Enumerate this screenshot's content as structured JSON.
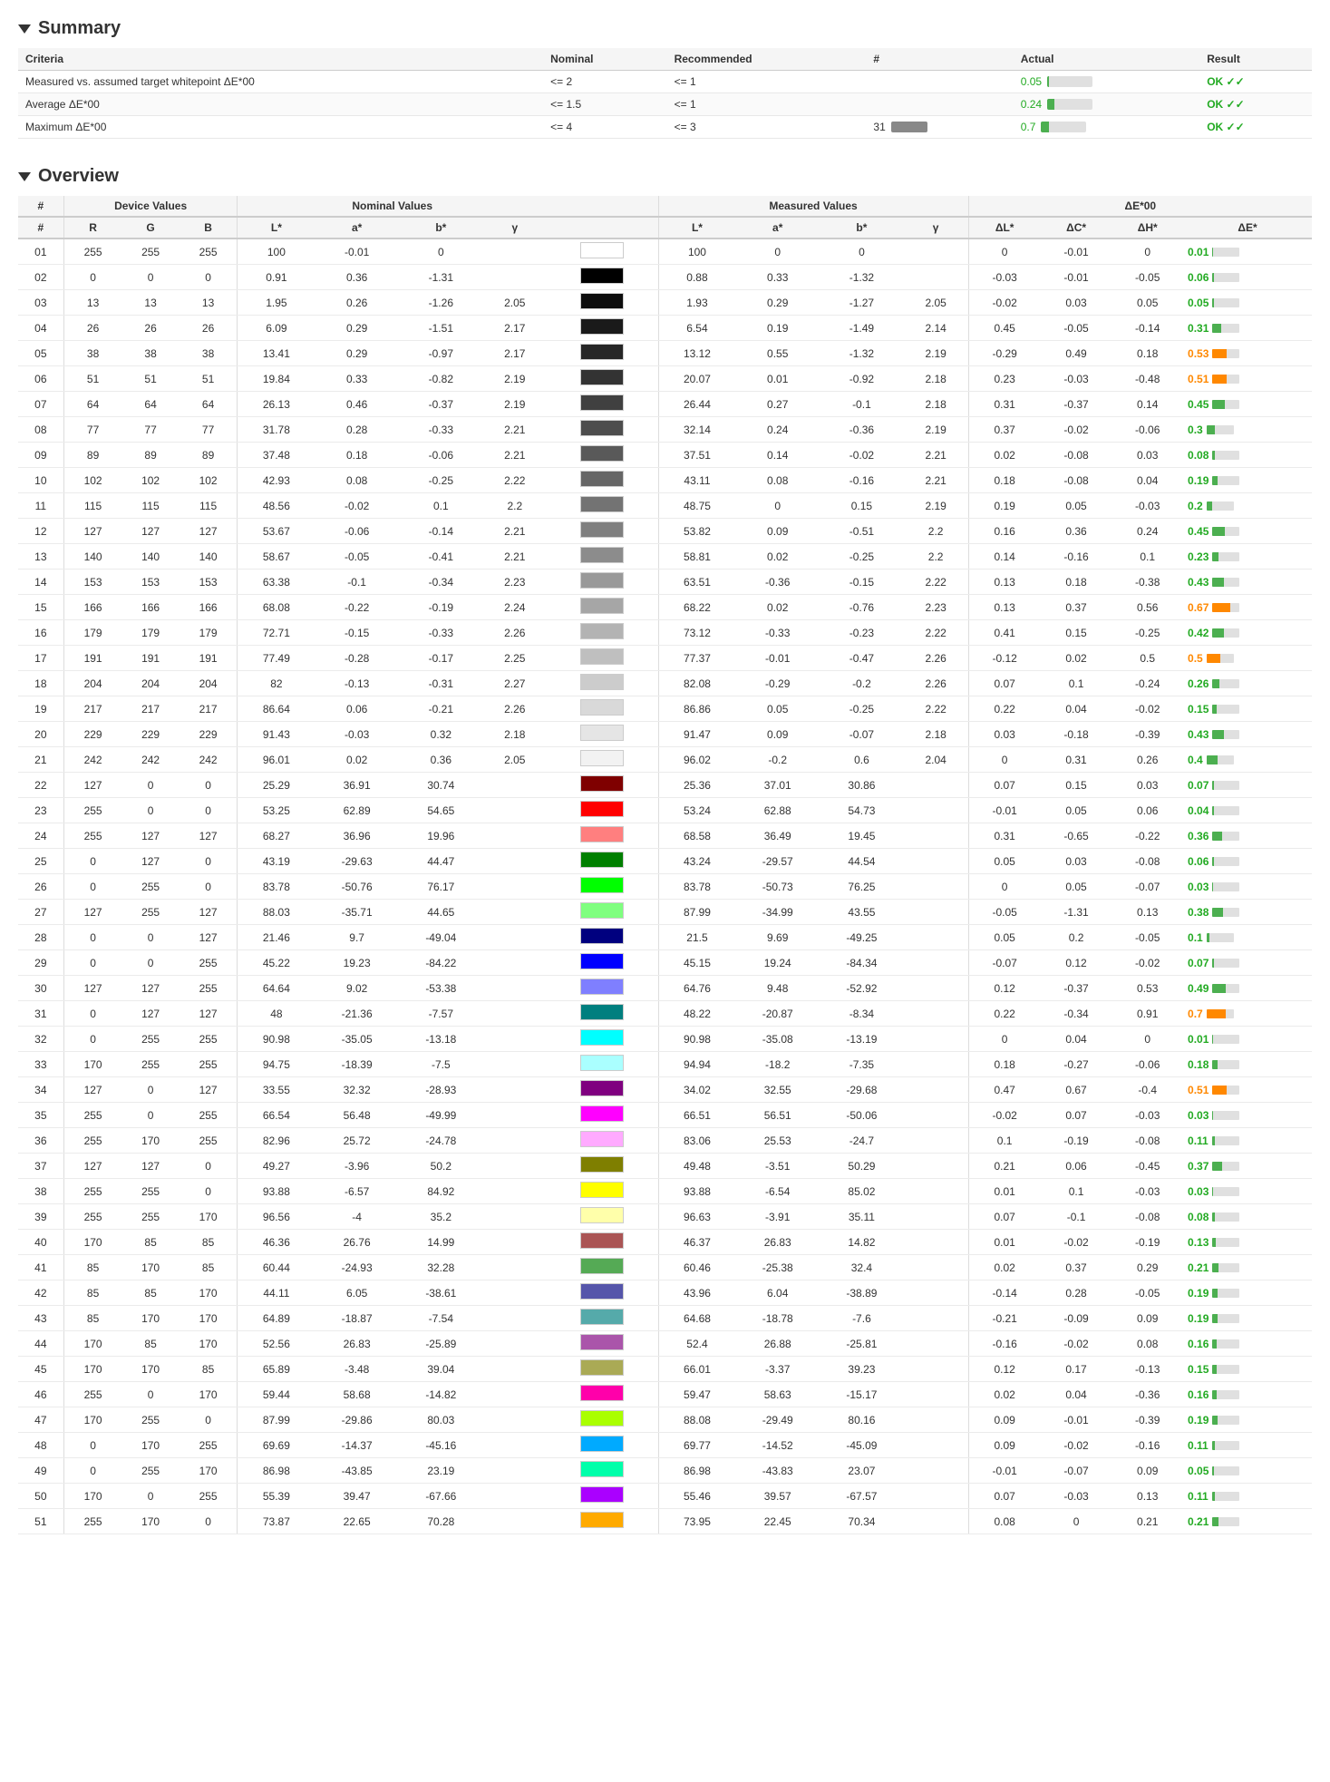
{
  "summary": {
    "title": "Summary",
    "headers": [
      "Criteria",
      "Nominal",
      "Recommended",
      "#",
      "Actual",
      "Result"
    ],
    "rows": [
      {
        "criteria": "Measured vs. assumed target whitepoint ΔE*00",
        "nominal": "<= 2",
        "recommended": "<= 1",
        "count": "",
        "actual": "0.05",
        "actualBarPct": 3,
        "result": "OK ✓✓"
      },
      {
        "criteria": "Average ΔE*00",
        "nominal": "<= 1.5",
        "recommended": "<= 1",
        "count": "",
        "actual": "0.24",
        "actualBarPct": 16,
        "result": "OK ✓✓"
      },
      {
        "criteria": "Maximum ΔE*00",
        "nominal": "<= 4",
        "recommended": "<= 3",
        "count": "31",
        "actual": "0.7",
        "actualBarPct": 18,
        "result": "OK ✓✓"
      }
    ]
  },
  "overview": {
    "title": "Overview",
    "groupHeaders": [
      "#",
      "Device Values",
      "",
      "",
      "Nominal Values",
      "",
      "",
      "",
      "Measured Values",
      "",
      "",
      "",
      "ΔE*00",
      "",
      "",
      ""
    ],
    "subHeaders": [
      "#",
      "R",
      "G",
      "B",
      "L*",
      "a*",
      "b*",
      "γ",
      "swatch",
      "L*",
      "a*",
      "b*",
      "γ",
      "ΔL*",
      "ΔC*",
      "ΔH*",
      "ΔE*"
    ],
    "rows": [
      {
        "num": "01",
        "R": 255,
        "G": 255,
        "B": 255,
        "Ln": 100,
        "an": -0.01,
        "bn": 0,
        "gn": "",
        "swatch": "#ffffff",
        "Lm": 100,
        "am": 0,
        "bm": 0,
        "gm": "",
        "dL": 0,
        "dC": -0.01,
        "dH": 0,
        "dE": 0.01
      },
      {
        "num": "02",
        "R": 0,
        "G": 0,
        "B": 0,
        "Ln": 0.91,
        "an": 0.36,
        "bn": -1.31,
        "gn": "",
        "swatch": "#000000",
        "Lm": 0.88,
        "am": 0.33,
        "bm": -1.32,
        "gm": "",
        "dL": -0.03,
        "dC": -0.01,
        "dH": -0.05,
        "dE": 0.06
      },
      {
        "num": "03",
        "R": 13,
        "G": 13,
        "B": 13,
        "Ln": 1.95,
        "an": 0.26,
        "bn": -1.26,
        "gn": 2.05,
        "swatch": "#0d0d0d",
        "Lm": 1.93,
        "am": 0.29,
        "bm": -1.27,
        "gm": 2.05,
        "dL": -0.02,
        "dC": 0.03,
        "dH": 0.05,
        "dE": 0.05
      },
      {
        "num": "04",
        "R": 26,
        "G": 26,
        "B": 26,
        "Ln": 6.09,
        "an": 0.29,
        "bn": -1.51,
        "gn": 2.17,
        "swatch": "#1a1a1a",
        "Lm": 6.54,
        "am": 0.19,
        "bm": -1.49,
        "gm": 2.14,
        "dL": 0.45,
        "dC": -0.05,
        "dH": -0.14,
        "dE": 0.31
      },
      {
        "num": "05",
        "R": 38,
        "G": 38,
        "B": 38,
        "Ln": 13.41,
        "an": 0.29,
        "bn": -0.97,
        "gn": 2.17,
        "swatch": "#262626",
        "Lm": 13.12,
        "am": 0.55,
        "bm": -1.32,
        "gm": 2.19,
        "dL": -0.29,
        "dC": 0.49,
        "dH": 0.18,
        "dE": 0.53
      },
      {
        "num": "06",
        "R": 51,
        "G": 51,
        "B": 51,
        "Ln": 19.84,
        "an": 0.33,
        "bn": -0.82,
        "gn": 2.19,
        "swatch": "#333333",
        "Lm": 20.07,
        "am": 0.01,
        "bm": -0.92,
        "gm": 2.18,
        "dL": 0.23,
        "dC": -0.03,
        "dH": -0.48,
        "dE": 0.51
      },
      {
        "num": "07",
        "R": 64,
        "G": 64,
        "B": 64,
        "Ln": 26.13,
        "an": 0.46,
        "bn": -0.37,
        "gn": 2.19,
        "swatch": "#404040",
        "Lm": 26.44,
        "am": 0.27,
        "bm": -0.1,
        "gm": 2.18,
        "dL": 0.31,
        "dC": -0.37,
        "dH": 0.14,
        "dE": 0.45
      },
      {
        "num": "08",
        "R": 77,
        "G": 77,
        "B": 77,
        "Ln": 31.78,
        "an": 0.28,
        "bn": -0.33,
        "gn": 2.21,
        "swatch": "#4d4d4d",
        "Lm": 32.14,
        "am": 0.24,
        "bm": -0.36,
        "gm": 2.19,
        "dL": 0.37,
        "dC": -0.02,
        "dH": -0.06,
        "dE": 0.3
      },
      {
        "num": "09",
        "R": 89,
        "G": 89,
        "B": 89,
        "Ln": 37.48,
        "an": 0.18,
        "bn": -0.06,
        "gn": 2.21,
        "swatch": "#595959",
        "Lm": 37.51,
        "am": 0.14,
        "bm": -0.02,
        "gm": 2.21,
        "dL": 0.02,
        "dC": -0.08,
        "dH": 0.03,
        "dE": 0.08
      },
      {
        "num": "10",
        "R": 102,
        "G": 102,
        "B": 102,
        "Ln": 42.93,
        "an": 0.08,
        "bn": -0.25,
        "gn": 2.22,
        "swatch": "#666666",
        "Lm": 43.11,
        "am": 0.08,
        "bm": -0.16,
        "gm": 2.21,
        "dL": 0.18,
        "dC": -0.08,
        "dH": 0.04,
        "dE": 0.19
      },
      {
        "num": "11",
        "R": 115,
        "G": 115,
        "B": 115,
        "Ln": 48.56,
        "an": -0.02,
        "bn": 0.1,
        "gn": 2.2,
        "swatch": "#737373",
        "Lm": 48.75,
        "am": 0,
        "bm": 0.15,
        "gm": 2.19,
        "dL": 0.19,
        "dC": 0.05,
        "dH": -0.03,
        "dE": 0.2
      },
      {
        "num": "12",
        "R": 127,
        "G": 127,
        "B": 127,
        "Ln": 53.67,
        "an": -0.06,
        "bn": -0.14,
        "gn": 2.21,
        "swatch": "#7f7f7f",
        "Lm": 53.82,
        "am": 0.09,
        "bm": -0.51,
        "gm": 2.2,
        "dL": 0.16,
        "dC": 0.36,
        "dH": 0.24,
        "dE": 0.45
      },
      {
        "num": "13",
        "R": 140,
        "G": 140,
        "B": 140,
        "Ln": 58.67,
        "an": -0.05,
        "bn": -0.41,
        "gn": 2.21,
        "swatch": "#8c8c8c",
        "Lm": 58.81,
        "am": 0.02,
        "bm": -0.25,
        "gm": 2.2,
        "dL": 0.14,
        "dC": -0.16,
        "dH": 0.1,
        "dE": 0.23
      },
      {
        "num": "14",
        "R": 153,
        "G": 153,
        "B": 153,
        "Ln": 63.38,
        "an": -0.1,
        "bn": -0.34,
        "gn": 2.23,
        "swatch": "#999999",
        "Lm": 63.51,
        "am": -0.36,
        "bm": -0.15,
        "gm": 2.22,
        "dL": 0.13,
        "dC": 0.18,
        "dH": -0.38,
        "dE": 0.43
      },
      {
        "num": "15",
        "R": 166,
        "G": 166,
        "B": 166,
        "Ln": 68.08,
        "an": -0.22,
        "bn": -0.19,
        "gn": 2.24,
        "swatch": "#a6a6a6",
        "Lm": 68.22,
        "am": 0.02,
        "bm": -0.76,
        "gm": 2.23,
        "dL": 0.13,
        "dC": 0.37,
        "dH": 0.56,
        "dE": 0.67
      },
      {
        "num": "16",
        "R": 179,
        "G": 179,
        "B": 179,
        "Ln": 72.71,
        "an": -0.15,
        "bn": -0.33,
        "gn": 2.26,
        "swatch": "#b3b3b3",
        "Lm": 73.12,
        "am": -0.33,
        "bm": -0.23,
        "gm": 2.22,
        "dL": 0.41,
        "dC": 0.15,
        "dH": -0.25,
        "dE": 0.42
      },
      {
        "num": "17",
        "R": 191,
        "G": 191,
        "B": 191,
        "Ln": 77.49,
        "an": -0.28,
        "bn": -0.17,
        "gn": 2.25,
        "swatch": "#bfbfbf",
        "Lm": 77.37,
        "am": -0.01,
        "bm": -0.47,
        "gm": 2.26,
        "dL": -0.12,
        "dC": 0.02,
        "dH": 0.5,
        "dE": 0.5
      },
      {
        "num": "18",
        "R": 204,
        "G": 204,
        "B": 204,
        "Ln": 82,
        "an": -0.13,
        "bn": -0.31,
        "gn": 2.27,
        "swatch": "#cccccc",
        "Lm": 82.08,
        "am": -0.29,
        "bm": -0.2,
        "gm": 2.26,
        "dL": 0.07,
        "dC": 0.1,
        "dH": -0.24,
        "dE": 0.26
      },
      {
        "num": "19",
        "R": 217,
        "G": 217,
        "B": 217,
        "Ln": 86.64,
        "an": 0.06,
        "bn": -0.21,
        "gn": 2.26,
        "swatch": "#d9d9d9",
        "Lm": 86.86,
        "am": 0.05,
        "bm": -0.25,
        "gm": 2.22,
        "dL": 0.22,
        "dC": 0.04,
        "dH": -0.02,
        "dE": 0.15
      },
      {
        "num": "20",
        "R": 229,
        "G": 229,
        "B": 229,
        "Ln": 91.43,
        "an": -0.03,
        "bn": 0.32,
        "gn": 2.18,
        "swatch": "#e5e5e5",
        "Lm": 91.47,
        "am": 0.09,
        "bm": -0.07,
        "gm": 2.18,
        "dL": 0.03,
        "dC": -0.18,
        "dH": -0.39,
        "dE": 0.43
      },
      {
        "num": "21",
        "R": 242,
        "G": 242,
        "B": 242,
        "Ln": 96.01,
        "an": 0.02,
        "bn": 0.36,
        "gn": 2.05,
        "swatch": "#f2f2f2",
        "Lm": 96.02,
        "am": -0.2,
        "bm": 0.6,
        "gm": 2.04,
        "dL": 0,
        "dC": 0.31,
        "dH": 0.26,
        "dE": 0.4
      },
      {
        "num": "22",
        "R": 127,
        "G": 0,
        "B": 0,
        "Ln": 25.29,
        "an": 36.91,
        "bn": 30.74,
        "gn": "",
        "swatch": "#7f0000",
        "Lm": 25.36,
        "am": 37.01,
        "bm": 30.86,
        "gm": "",
        "dL": 0.07,
        "dC": 0.15,
        "dH": 0.03,
        "dE": 0.07
      },
      {
        "num": "23",
        "R": 255,
        "G": 0,
        "B": 0,
        "Ln": 53.25,
        "an": 62.89,
        "bn": 54.65,
        "gn": "",
        "swatch": "#ff0000",
        "Lm": 53.24,
        "am": 62.88,
        "bm": 54.73,
        "gm": "",
        "dL": -0.01,
        "dC": 0.05,
        "dH": 0.06,
        "dE": 0.04
      },
      {
        "num": "24",
        "R": 255,
        "G": 127,
        "B": 127,
        "Ln": 68.27,
        "an": 36.96,
        "bn": 19.96,
        "gn": "",
        "swatch": "#ff7f7f",
        "Lm": 68.58,
        "am": 36.49,
        "bm": 19.45,
        "gm": "",
        "dL": 0.31,
        "dC": -0.65,
        "dH": -0.22,
        "dE": 0.36
      },
      {
        "num": "25",
        "R": 0,
        "G": 127,
        "B": 0,
        "Ln": 43.19,
        "an": -29.63,
        "bn": 44.47,
        "gn": "",
        "swatch": "#007f00",
        "Lm": 43.24,
        "am": -29.57,
        "bm": 44.54,
        "gm": "",
        "dL": 0.05,
        "dC": 0.03,
        "dH": -0.08,
        "dE": 0.06
      },
      {
        "num": "26",
        "R": 0,
        "G": 255,
        "B": 0,
        "Ln": 83.78,
        "an": -50.76,
        "bn": 76.17,
        "gn": "",
        "swatch": "#00ff00",
        "Lm": 83.78,
        "am": -50.73,
        "bm": 76.25,
        "gm": "",
        "dL": 0,
        "dC": 0.05,
        "dH": -0.07,
        "dE": 0.03
      },
      {
        "num": "27",
        "R": 127,
        "G": 255,
        "B": 127,
        "Ln": 88.03,
        "an": -35.71,
        "bn": 44.65,
        "gn": "",
        "swatch": "#7fff7f",
        "Lm": 87.99,
        "am": -34.99,
        "bm": 43.55,
        "gm": "",
        "dL": -0.05,
        "dC": -1.31,
        "dH": 0.13,
        "dE": 0.38
      },
      {
        "num": "28",
        "R": 0,
        "G": 0,
        "B": 127,
        "Ln": 21.46,
        "an": 9.7,
        "bn": -49.04,
        "gn": "",
        "swatch": "#00007f",
        "Lm": 21.5,
        "am": 9.69,
        "bm": -49.25,
        "gm": "",
        "dL": 0.05,
        "dC": 0.2,
        "dH": -0.05,
        "dE": 0.1
      },
      {
        "num": "29",
        "R": 0,
        "G": 0,
        "B": 255,
        "Ln": 45.22,
        "an": 19.23,
        "bn": -84.22,
        "gn": "",
        "swatch": "#0000ff",
        "Lm": 45.15,
        "am": 19.24,
        "bm": -84.34,
        "gm": "",
        "dL": -0.07,
        "dC": 0.12,
        "dH": -0.02,
        "dE": 0.07
      },
      {
        "num": "30",
        "R": 127,
        "G": 127,
        "B": 255,
        "Ln": 64.64,
        "an": 9.02,
        "bn": -53.38,
        "gn": "",
        "swatch": "#7f7fff",
        "Lm": 64.76,
        "am": 9.48,
        "bm": -52.92,
        "gm": "",
        "dL": 0.12,
        "dC": -0.37,
        "dH": 0.53,
        "dE": 0.49
      },
      {
        "num": "31",
        "R": 0,
        "G": 127,
        "B": 127,
        "Ln": 48,
        "an": -21.36,
        "bn": -7.57,
        "gn": "",
        "swatch": "#007f7f",
        "Lm": 48.22,
        "am": -20.87,
        "bm": -8.34,
        "gm": "",
        "dL": 0.22,
        "dC": -0.34,
        "dH": 0.91,
        "dE": 0.7
      },
      {
        "num": "32",
        "R": 0,
        "G": 255,
        "B": 255,
        "Ln": 90.98,
        "an": -35.05,
        "bn": -13.18,
        "gn": "",
        "swatch": "#00ffff",
        "Lm": 90.98,
        "am": -35.08,
        "bm": -13.19,
        "gm": "",
        "dL": 0,
        "dC": 0.04,
        "dH": 0,
        "dE": 0.01
      },
      {
        "num": "33",
        "R": 170,
        "G": 255,
        "B": 255,
        "Ln": 94.75,
        "an": -18.39,
        "bn": -7.5,
        "gn": "",
        "swatch": "#aaffff",
        "Lm": 94.94,
        "am": -18.2,
        "bm": -7.35,
        "gm": "",
        "dL": 0.18,
        "dC": -0.27,
        "dH": -0.06,
        "dE": 0.18
      },
      {
        "num": "34",
        "R": 127,
        "G": 0,
        "B": 127,
        "Ln": 33.55,
        "an": 32.32,
        "bn": -28.93,
        "gn": "",
        "swatch": "#7f007f",
        "Lm": 34.02,
        "am": 32.55,
        "bm": -29.68,
        "gm": "",
        "dL": 0.47,
        "dC": 0.67,
        "dH": -0.4,
        "dE": 0.51
      },
      {
        "num": "35",
        "R": 255,
        "G": 0,
        "B": 255,
        "Ln": 66.54,
        "an": 56.48,
        "bn": -49.99,
        "gn": "",
        "swatch": "#ff00ff",
        "Lm": 66.51,
        "am": 56.51,
        "bm": -50.06,
        "gm": "",
        "dL": -0.02,
        "dC": 0.07,
        "dH": -0.03,
        "dE": 0.03
      },
      {
        "num": "36",
        "R": 255,
        "G": 170,
        "B": 255,
        "Ln": 82.96,
        "an": 25.72,
        "bn": -24.78,
        "gn": "",
        "swatch": "#ffaaff",
        "Lm": 83.06,
        "am": 25.53,
        "bm": -24.7,
        "gm": "",
        "dL": 0.1,
        "dC": -0.19,
        "dH": -0.08,
        "dE": 0.11
      },
      {
        "num": "37",
        "R": 127,
        "G": 127,
        "B": 0,
        "Ln": 49.27,
        "an": -3.96,
        "bn": 50.2,
        "gn": "",
        "swatch": "#7f7f00",
        "Lm": 49.48,
        "am": -3.51,
        "bm": 50.29,
        "gm": "",
        "dL": 0.21,
        "dC": 0.06,
        "dH": -0.45,
        "dE": 0.37
      },
      {
        "num": "38",
        "R": 255,
        "G": 255,
        "B": 0,
        "Ln": 93.88,
        "an": -6.57,
        "bn": 84.92,
        "gn": "",
        "swatch": "#ffff00",
        "Lm": 93.88,
        "am": -6.54,
        "bm": 85.02,
        "gm": "",
        "dL": 0.01,
        "dC": 0.1,
        "dH": -0.03,
        "dE": 0.03
      },
      {
        "num": "39",
        "R": 255,
        "G": 255,
        "B": 170,
        "Ln": 96.56,
        "an": -4,
        "bn": 35.2,
        "gn": "",
        "swatch": "#ffffaa",
        "Lm": 96.63,
        "am": -3.91,
        "bm": 35.11,
        "gm": "",
        "dL": 0.07,
        "dC": -0.1,
        "dH": -0.08,
        "dE": 0.08
      },
      {
        "num": "40",
        "R": 170,
        "G": 85,
        "B": 85,
        "Ln": 46.36,
        "an": 26.76,
        "bn": 14.99,
        "gn": "",
        "swatch": "#aa5555",
        "Lm": 46.37,
        "am": 26.83,
        "bm": 14.82,
        "gm": "",
        "dL": 0.01,
        "dC": -0.02,
        "dH": -0.19,
        "dE": 0.13
      },
      {
        "num": "41",
        "R": 85,
        "G": 170,
        "B": 85,
        "Ln": 60.44,
        "an": -24.93,
        "bn": 32.28,
        "gn": "",
        "swatch": "#55aa55",
        "Lm": 60.46,
        "am": -25.38,
        "bm": 32.4,
        "gm": "",
        "dL": 0.02,
        "dC": 0.37,
        "dH": 0.29,
        "dE": 0.21
      },
      {
        "num": "42",
        "R": 85,
        "G": 85,
        "B": 170,
        "Ln": 44.11,
        "an": 6.05,
        "bn": -38.61,
        "gn": "",
        "swatch": "#5555aa",
        "Lm": 43.96,
        "am": 6.04,
        "bm": -38.89,
        "gm": "",
        "dL": -0.14,
        "dC": 0.28,
        "dH": -0.05,
        "dE": 0.19
      },
      {
        "num": "43",
        "R": 85,
        "G": 170,
        "B": 170,
        "Ln": 64.89,
        "an": -18.87,
        "bn": -7.54,
        "gn": "",
        "swatch": "#55aaaa",
        "Lm": 64.68,
        "am": -18.78,
        "bm": -7.6,
        "gm": "",
        "dL": -0.21,
        "dC": -0.09,
        "dH": 0.09,
        "dE": 0.19
      },
      {
        "num": "44",
        "R": 170,
        "G": 85,
        "B": 170,
        "Ln": 52.56,
        "an": 26.83,
        "bn": -25.89,
        "gn": "",
        "swatch": "#aa55aa",
        "Lm": 52.4,
        "am": 26.88,
        "bm": -25.81,
        "gm": "",
        "dL": -0.16,
        "dC": -0.02,
        "dH": 0.08,
        "dE": 0.16
      },
      {
        "num": "45",
        "R": 170,
        "G": 170,
        "B": 85,
        "Ln": 65.89,
        "an": -3.48,
        "bn": 39.04,
        "gn": "",
        "swatch": "#aaaa55",
        "Lm": 66.01,
        "am": -3.37,
        "bm": 39.23,
        "gm": "",
        "dL": 0.12,
        "dC": 0.17,
        "dH": -0.13,
        "dE": 0.15
      },
      {
        "num": "46",
        "R": 255,
        "G": 0,
        "B": 170,
        "Ln": 59.44,
        "an": 58.68,
        "bn": -14.82,
        "gn": "",
        "swatch": "#ff00aa",
        "Lm": 59.47,
        "am": 58.63,
        "bm": -15.17,
        "gm": "",
        "dL": 0.02,
        "dC": 0.04,
        "dH": -0.36,
        "dE": 0.16
      },
      {
        "num": "47",
        "R": 170,
        "G": 255,
        "B": 0,
        "Ln": 87.99,
        "an": -29.86,
        "bn": 80.03,
        "gn": "",
        "swatch": "#aaff00",
        "Lm": 88.08,
        "am": -29.49,
        "bm": 80.16,
        "gm": "",
        "dL": 0.09,
        "dC": -0.01,
        "dH": -0.39,
        "dE": 0.19
      },
      {
        "num": "48",
        "R": 0,
        "G": 170,
        "B": 255,
        "Ln": 69.69,
        "an": -14.37,
        "bn": -45.16,
        "gn": "",
        "swatch": "#00aaff",
        "Lm": 69.77,
        "am": -14.52,
        "bm": -45.09,
        "gm": "",
        "dL": 0.09,
        "dC": -0.02,
        "dH": -0.16,
        "dE": 0.11
      },
      {
        "num": "49",
        "R": 0,
        "G": 255,
        "B": 170,
        "Ln": 86.98,
        "an": -43.85,
        "bn": 23.19,
        "gn": "",
        "swatch": "#00ffaa",
        "Lm": 86.98,
        "am": -43.83,
        "bm": 23.07,
        "gm": "",
        "dL": -0.01,
        "dC": -0.07,
        "dH": 0.09,
        "dE": 0.05
      },
      {
        "num": "50",
        "R": 170,
        "G": 0,
        "B": 255,
        "Ln": 55.39,
        "an": 39.47,
        "bn": -67.66,
        "gn": "",
        "swatch": "#aa00ff",
        "Lm": 55.46,
        "am": 39.57,
        "bm": -67.57,
        "gm": "",
        "dL": 0.07,
        "dC": -0.03,
        "dH": 0.13,
        "dE": 0.11
      },
      {
        "num": "51",
        "R": 255,
        "G": 170,
        "B": 0,
        "Ln": 73.87,
        "an": 22.65,
        "bn": 70.28,
        "gn": "",
        "swatch": "#ffaa00",
        "Lm": 73.95,
        "am": 22.45,
        "bm": 70.34,
        "gm": "",
        "dL": 0.08,
        "dC": 0,
        "dH": 0.21,
        "dE": 0.21
      }
    ]
  }
}
